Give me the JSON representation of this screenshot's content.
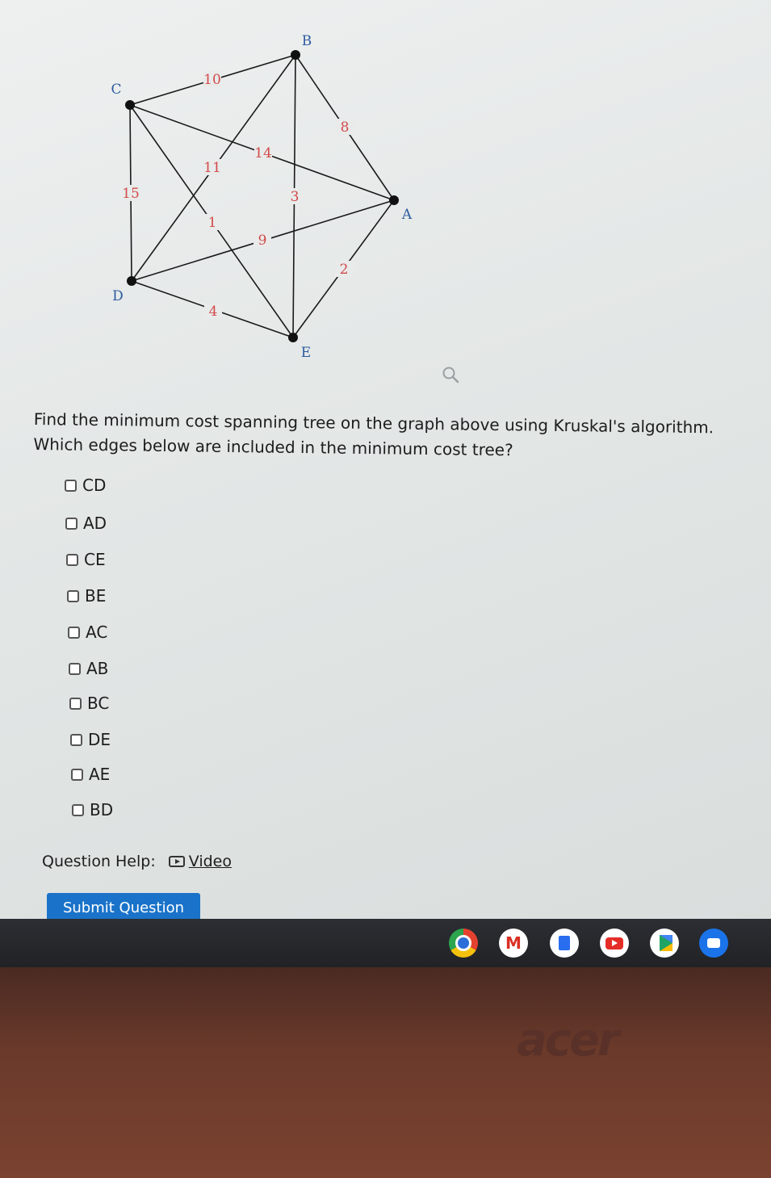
{
  "graph": {
    "vertices": [
      {
        "id": "B",
        "label": "B"
      },
      {
        "id": "C",
        "label": "C"
      },
      {
        "id": "A",
        "label": "A"
      },
      {
        "id": "D",
        "label": "D"
      },
      {
        "id": "E",
        "label": "E"
      }
    ],
    "edges": [
      {
        "from": "C",
        "to": "B",
        "weight": "10"
      },
      {
        "from": "B",
        "to": "A",
        "weight": "8"
      },
      {
        "from": "C",
        "to": "A",
        "weight": "14"
      },
      {
        "from": "B",
        "to": "D",
        "weight": "11"
      },
      {
        "from": "C",
        "to": "D",
        "weight": "15"
      },
      {
        "from": "B",
        "to": "E",
        "weight": "3"
      },
      {
        "from": "C",
        "to": "E",
        "weight": "1"
      },
      {
        "from": "D",
        "to": "A",
        "weight": "9"
      },
      {
        "from": "A",
        "to": "E",
        "weight": "2"
      },
      {
        "from": "D",
        "to": "E",
        "weight": "4"
      }
    ]
  },
  "question": {
    "text": "Find the minimum cost spanning tree on the graph above using Kruskal's algorithm. Which edges below are included in the minimum cost tree?"
  },
  "options": [
    "CD",
    "AD",
    "CE",
    "BE",
    "AC",
    "AB",
    "BC",
    "DE",
    "AE",
    "BD"
  ],
  "help": {
    "label": "Question Help:",
    "video_label": "Video"
  },
  "submit_label": "Submit Question",
  "shelf": {
    "apps": [
      {
        "name": "chrome-icon",
        "color": "#e5412f"
      },
      {
        "name": "gmail-icon",
        "color": "#ffffff"
      },
      {
        "name": "docs-icon",
        "color": "#ffffff"
      },
      {
        "name": "youtube-icon",
        "color": "#ffffff"
      },
      {
        "name": "play-store-icon",
        "color": "#ffffff"
      },
      {
        "name": "messages-icon",
        "color": "#1a73e8"
      }
    ]
  },
  "bezel": {
    "brand": "acer"
  }
}
